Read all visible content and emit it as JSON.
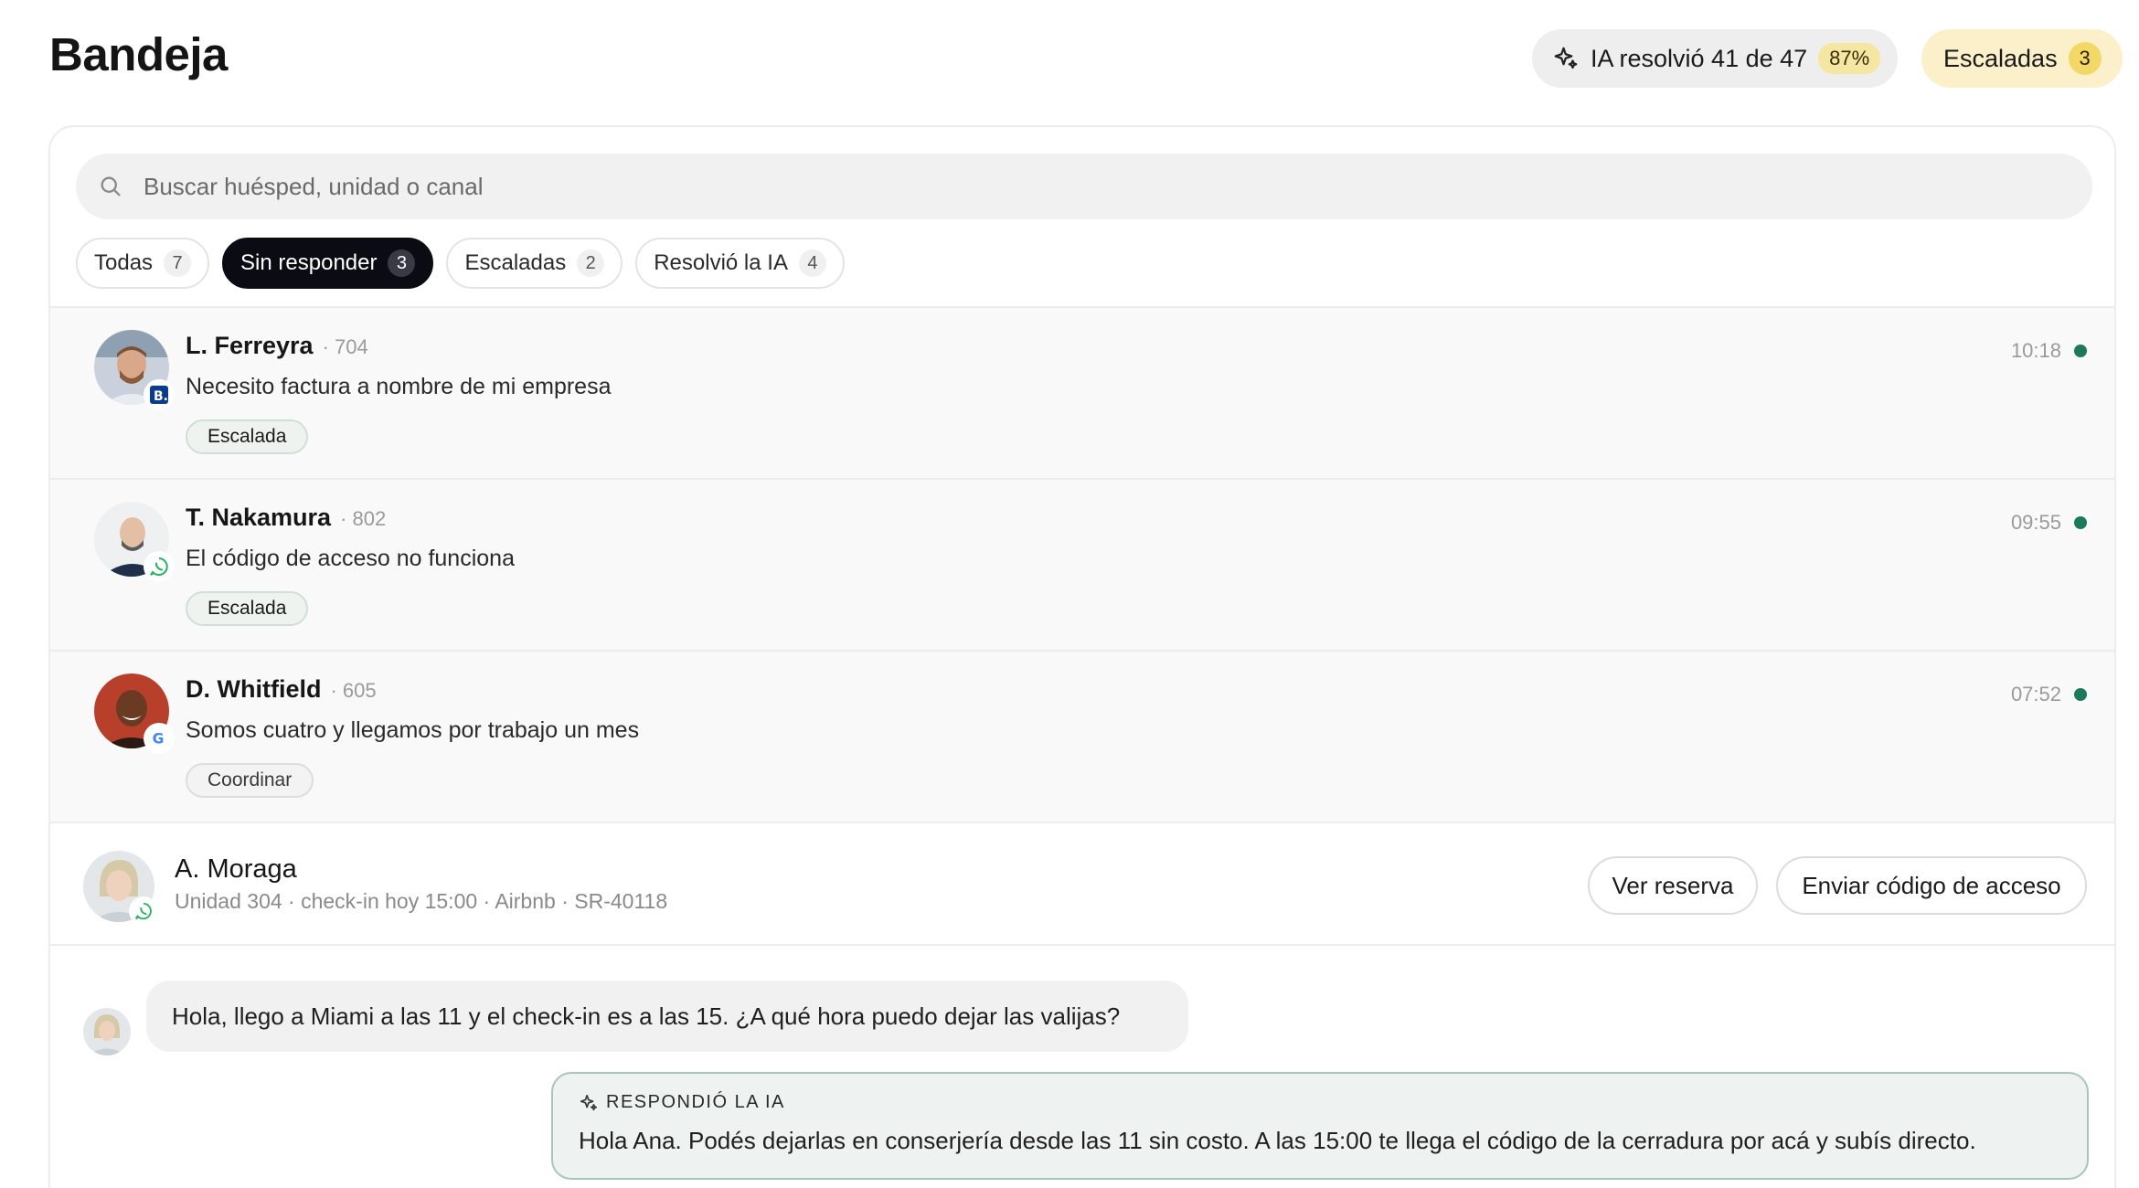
{
  "header": {
    "title": "Bandeja",
    "ai_summary": {
      "label": "IA resolvió 41 de 47",
      "percent": "87%",
      "icon": "sparkles-icon"
    },
    "escalated": {
      "label": "Escaladas",
      "count": "3"
    }
  },
  "search": {
    "placeholder": "Buscar huésped, unidad o canal",
    "icon": "search-icon"
  },
  "filters": [
    {
      "label": "Todas",
      "count": "7",
      "active": false
    },
    {
      "label": "Sin responder",
      "count": "3",
      "active": true
    },
    {
      "label": "Escaladas",
      "count": "2",
      "active": false
    },
    {
      "label": "Resolvió la IA",
      "count": "4",
      "active": false
    }
  ],
  "conversations": [
    {
      "name": "L. Ferreyra",
      "unit": "· 704",
      "message": "Necesito factura a nombre de mi empresa",
      "tag": "Escalada",
      "time": "10:18",
      "channel": "booking-icon",
      "unread": true
    },
    {
      "name": "T. Nakamura",
      "unit": "· 802",
      "message": "El código de acceso no funciona",
      "tag": "Escalada",
      "time": "09:55",
      "channel": "whatsapp-icon",
      "unread": true
    },
    {
      "name": "D. Whitfield",
      "unit": "· 605",
      "message": "Somos cuatro y llegamos por trabajo un mes",
      "tag": "Coordinar",
      "time": "07:52",
      "channel": "google-icon",
      "unread": true
    }
  ],
  "detail": {
    "name": "A. Moraga",
    "meta": "Unidad 304 · check-in hoy 15:00 · Airbnb · SR-40118",
    "channel": "whatsapp-icon",
    "buttons": {
      "view": "Ver reserva",
      "send": "Enviar código de acceso"
    }
  },
  "messages": {
    "guest": "Hola, llego a Miami a las 11 y el check-in es a las 15. ¿A qué hora puedo dejar las valijas?",
    "ai_label": "RESPONDIÓ LA IA",
    "ai_reply": "Hola Ana. Podés dejarlas en conserjería desde las 11 sin costo. A las 15:00 te llega el código de la cerradura por acá y subís directo."
  },
  "colors": {
    "accent_dark": "#0b0b14",
    "unread_dot": "#1b7a5c",
    "ai_border": "#a8c6b8",
    "escalated_bg": "#fbf0c9"
  }
}
